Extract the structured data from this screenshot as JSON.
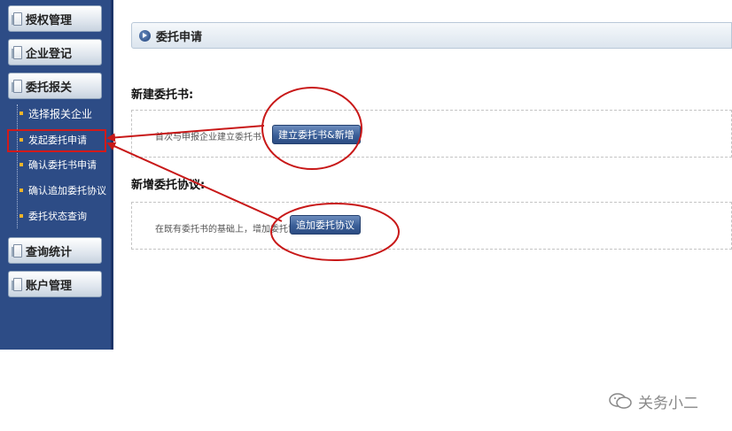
{
  "sidebar": {
    "sections": [
      {
        "label": "授权管理"
      },
      {
        "label": "企业登记"
      },
      {
        "label": "委托报关"
      },
      {
        "label": "查询统计"
      },
      {
        "label": "账户管理"
      }
    ],
    "sub_items": [
      {
        "label": "选择报关企业"
      },
      {
        "label": "发起委托申请"
      },
      {
        "label": "确认委托书申请"
      },
      {
        "label": "确认追加委托协议"
      },
      {
        "label": "委托状态查询"
      }
    ]
  },
  "main": {
    "title": "委托申请",
    "section1": {
      "heading": "新建委托书:",
      "description": "首次与申报企业建立委托书",
      "button_label": "建立委托书&新增"
    },
    "section2": {
      "heading": "新增委托协议:",
      "description": "在既有委托书的基础上，增加委托协议",
      "button_label": "追加委托协议"
    }
  },
  "watermark": {
    "text": "关务小二"
  },
  "colors": {
    "sidebar_bg": "#2d4c86",
    "button_blue": "#3b5f98",
    "annotation_red": "#d21a1a",
    "bullet": "#f0b429"
  }
}
